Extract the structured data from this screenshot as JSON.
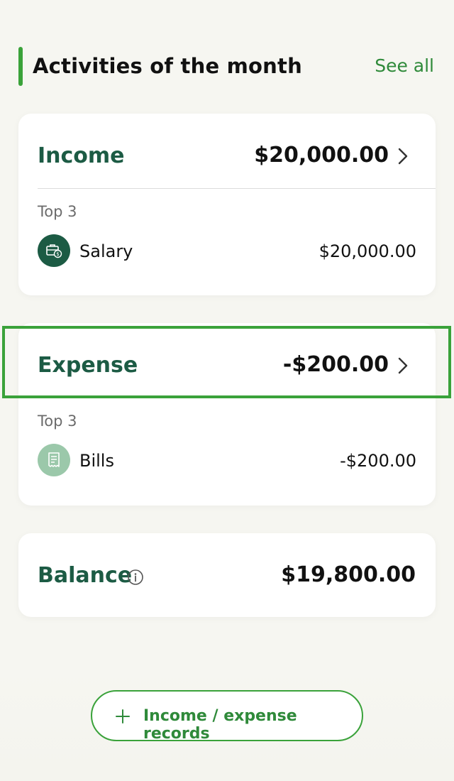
{
  "section": {
    "title": "Activities of the month",
    "see_all": "See all"
  },
  "income": {
    "label": "Income",
    "total": "$20,000.00",
    "top_label": "Top 3",
    "items": [
      {
        "label": "Salary",
        "amount": "$20,000.00",
        "icon": "salary-briefcase-icon"
      }
    ]
  },
  "expense": {
    "label": "Expense",
    "total": "-$200.00",
    "top_label": "Top 3",
    "items": [
      {
        "label": "Bills",
        "amount": "-$200.00",
        "icon": "bills-receipt-icon"
      }
    ]
  },
  "balance": {
    "label": "Balance",
    "total": "$19,800.00"
  },
  "records_button": {
    "label": "Income / expense records"
  },
  "colors": {
    "brand_dark_green": "#1c5b44",
    "accent_green": "#3aa23a",
    "link_green": "#2f8a3a",
    "background": "#f6f6f1"
  }
}
